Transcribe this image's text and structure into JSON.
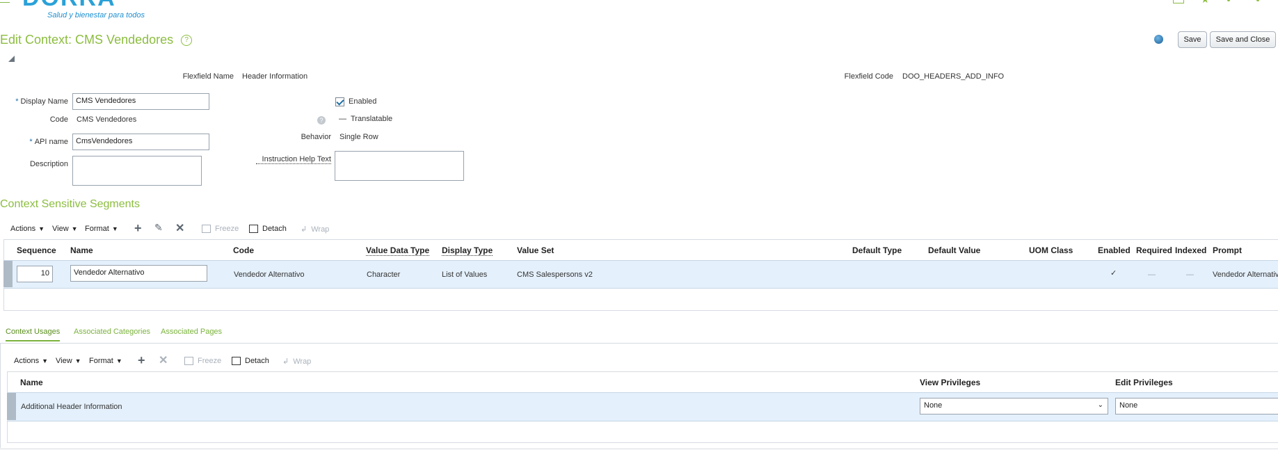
{
  "header": {
    "logo_text": "DORRA",
    "tagline": "Salud y bienestar para todos"
  },
  "page": {
    "title": "Edit Context: CMS Vendedores",
    "help": "?",
    "save_label": "Save",
    "save_close_label": "Save and Close"
  },
  "form": {
    "flexfield_name_label": "Flexfield Name",
    "flexfield_name_value": "Header Information",
    "flexfield_code_label": "Flexfield Code",
    "flexfield_code_value": "DOO_HEADERS_ADD_INFO",
    "display_name_label": "Display Name",
    "display_name_value": "CMS Vendedores",
    "code_label": "Code",
    "code_value": "CMS Vendedores",
    "api_name_label": "API name",
    "api_name_value": "CmsVendedores",
    "description_label": "Description",
    "enabled_label": "Enabled",
    "translatable_label": "Translatable",
    "behavior_label": "Behavior",
    "behavior_value": "Single Row",
    "instruction_help_label": "Instruction Help Text",
    "required_mark": "*"
  },
  "segments": {
    "title": "Context Sensitive Segments",
    "toolbar": {
      "actions": "Actions",
      "view": "View",
      "format": "Format",
      "freeze": "Freeze",
      "detach": "Detach",
      "wrap": "Wrap"
    },
    "columns": {
      "sequence": "Sequence",
      "name": "Name",
      "code": "Code",
      "value_data_type": "Value Data Type",
      "display_type": "Display Type",
      "value_set": "Value Set",
      "default_type": "Default Type",
      "default_value": "Default Value",
      "uom_class": "UOM Class",
      "enabled": "Enabled",
      "required": "Required",
      "indexed": "Indexed",
      "prompt": "Prompt"
    },
    "row": {
      "sequence": "10",
      "name": "Vendedor Alternativo",
      "code": "Vendedor Alternativo",
      "value_data_type": "Character",
      "display_type": "List of Values",
      "value_set": "CMS Salespersons v2",
      "enabled": "✓",
      "required": "—",
      "indexed": "—",
      "prompt": "Vendedor Alternativo"
    }
  },
  "tabs": {
    "context_usages": "Context Usages",
    "associated_categories": "Associated Categories",
    "associated_pages": "Associated Pages"
  },
  "usages": {
    "toolbar": {
      "actions": "Actions",
      "view": "View",
      "format": "Format",
      "freeze": "Freeze",
      "detach": "Detach",
      "wrap": "Wrap"
    },
    "columns": {
      "name": "Name",
      "view_privileges": "View Privileges",
      "edit_privileges": "Edit Privileges"
    },
    "row": {
      "name": "Additional Header Information",
      "view_privileges": "None",
      "edit_privileges": "None"
    }
  }
}
